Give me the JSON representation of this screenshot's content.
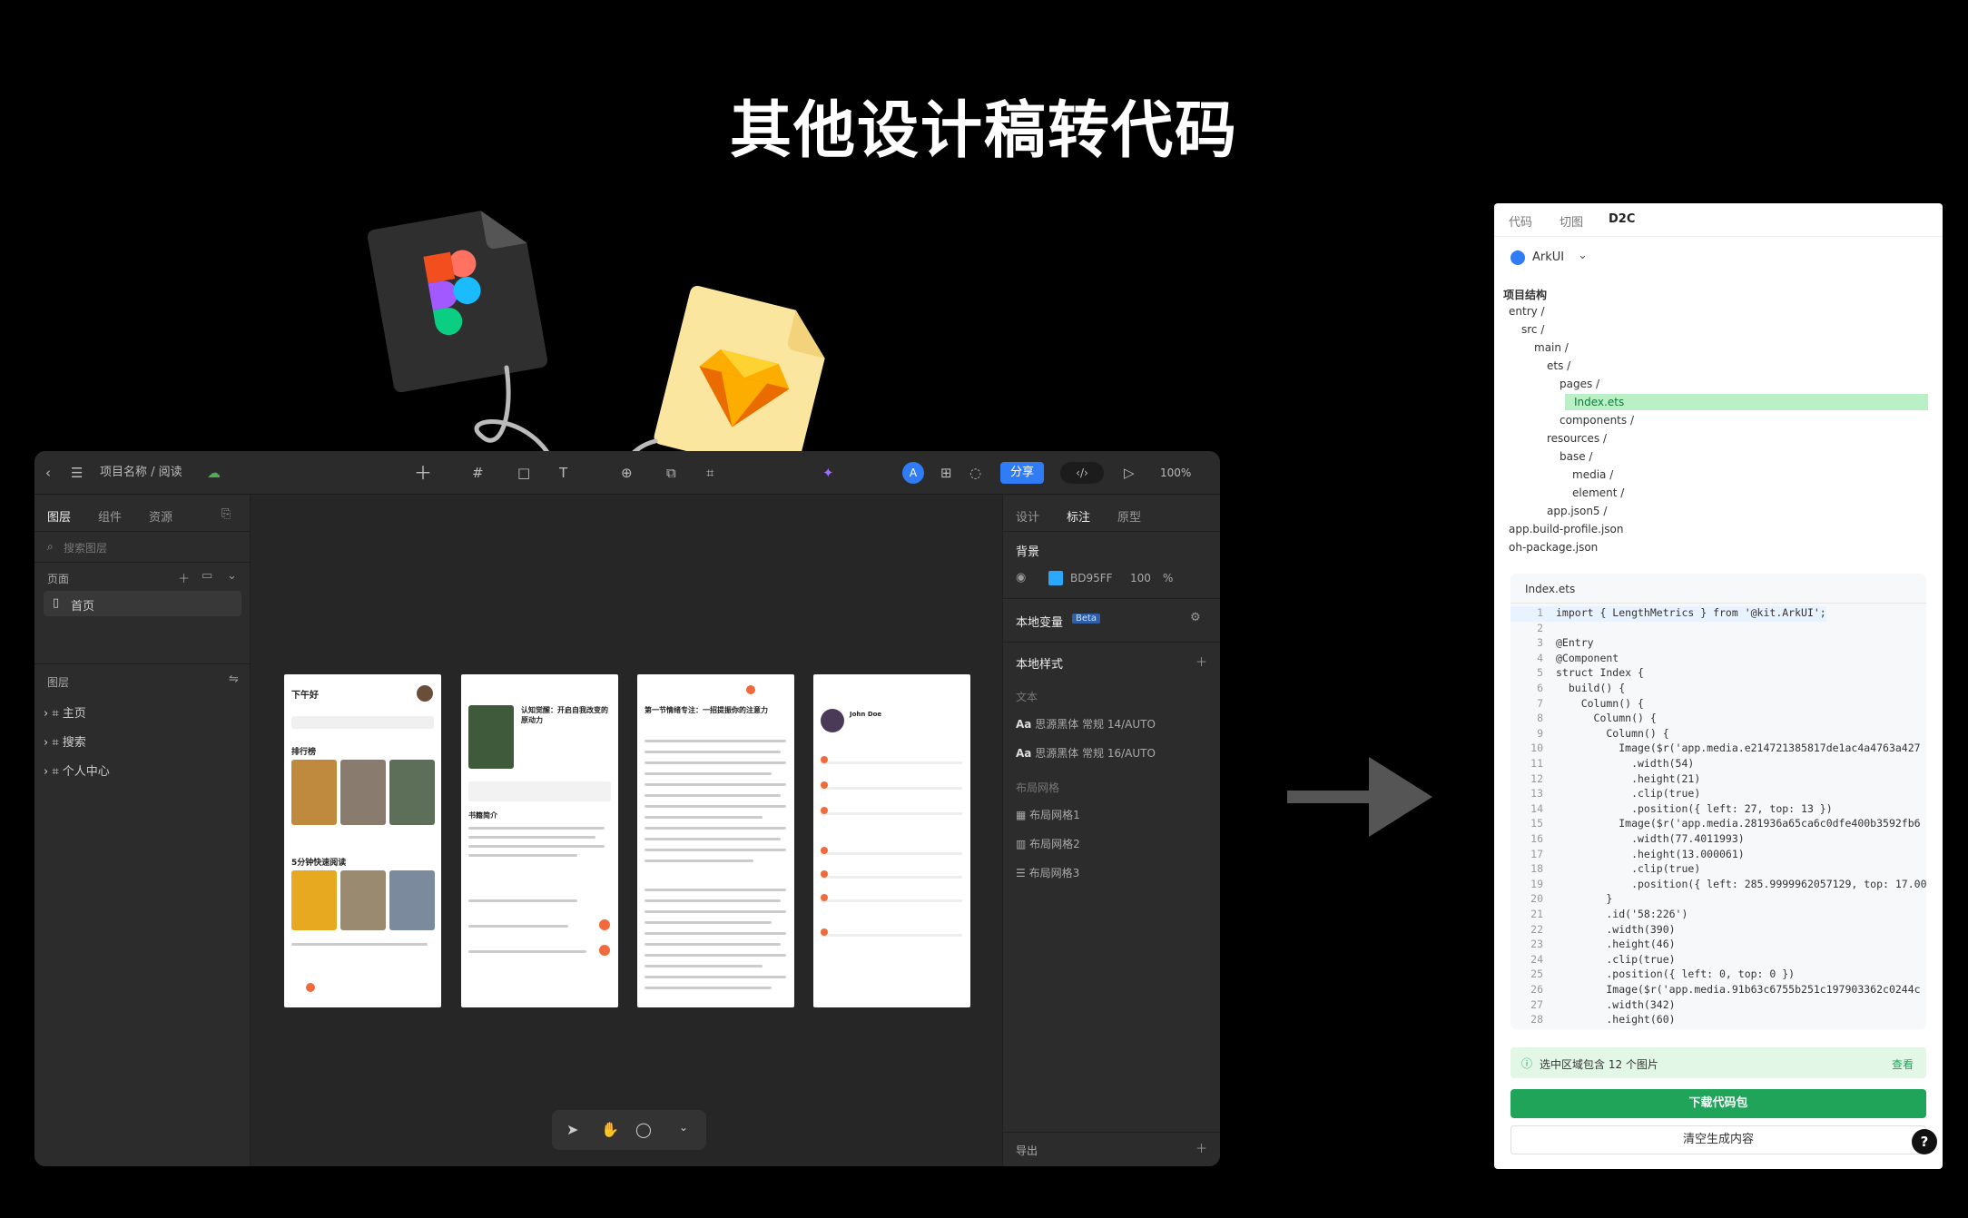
{
  "title": "其他设计稿转代码",
  "editor": {
    "breadcrumb": "项目名称 / 阅读",
    "share_label": "分享",
    "zoom": "100%",
    "avatar_letter": "A",
    "left_tabs": [
      "图层",
      "组件",
      "资源"
    ],
    "search_placeholder": "搜索图层",
    "pages_label": "页面",
    "page_item": "首页",
    "layers_label": "图层",
    "layers": [
      "主页",
      "搜索",
      "个人中心"
    ],
    "right_tabs": [
      "设计",
      "标注",
      "原型"
    ],
    "bg_label": "背景",
    "bg_color": "BD95FF",
    "bg_opacity": "100",
    "bg_unit": "%",
    "local_vars": "本地变量",
    "beta": "Beta",
    "local_styles": "本地样式",
    "text_label": "文本",
    "text_styles": [
      "思源黑体 常规 14/AUTO",
      "思源黑体 常规 16/AUTO"
    ],
    "grid_label": "布局网格",
    "grids": [
      "布局网格1",
      "布局网格2",
      "布局网格3"
    ],
    "export_label": "导出"
  },
  "frames": {
    "f1_title": "下午好",
    "f1_rank": "排行榜",
    "f1_quick": "5分钟快速阅读",
    "f2_title": "认知觉醒：开启自我改变的原动力",
    "f2_intro": "书籍简介",
    "f3_title": "第一节情绪专注：一招提振你的注意力",
    "f4_name": "John Doe"
  },
  "code_panel": {
    "tabs": [
      "代码",
      "切图",
      "D2C"
    ],
    "framework": "ArkUI",
    "structure_label": "项目结构",
    "tree": [
      "entry /",
      "src /",
      "main /",
      "ets /",
      "pages /",
      "Index.ets",
      "components /",
      "resources /",
      "base /",
      "media /",
      "element /",
      "app.json5 /",
      "app.build-profile.json",
      "oh-package.json"
    ],
    "file_name": "Index.ets",
    "lines": [
      "import { LengthMetrics } from '@kit.ArkUI';",
      "",
      "@Entry",
      "@Component",
      "struct Index {",
      "  build() {",
      "    Column() {",
      "      Column() {",
      "        Column() {",
      "          Image($r('app.media.e214721385817de1ac4a4763a427",
      "            .width(54)",
      "            .height(21)",
      "            .clip(true)",
      "            .position({ left: 27, top: 13 })",
      "          Image($r('app.media.281936a65ca6c0dfe400b3592fb6",
      "            .width(77.4011993)",
      "            .height(13.000061)",
      "            .clip(true)",
      "            .position({ left: 285.9999962057129, top: 17.000",
      "        }",
      "        .id('58:226')",
      "        .width(390)",
      "        .height(46)",
      "        .clip(true)",
      "        .position({ left: 0, top: 0 })",
      "        Image($r('app.media.91b63c6755b251c197903362c0244c",
      "        .width(342)",
      "        .height(60)"
    ],
    "notice": "选中区域包含 12 个图片",
    "notice_link": "查看",
    "download_label": "下载代码包",
    "clear_label": "清空生成内容",
    "help": "?"
  },
  "colors": {
    "accent_blue": "#2f7cf6",
    "green": "#1fa45a",
    "figma_bg": "#2b2b2b",
    "sketch_bg": "#fbe6a0"
  }
}
